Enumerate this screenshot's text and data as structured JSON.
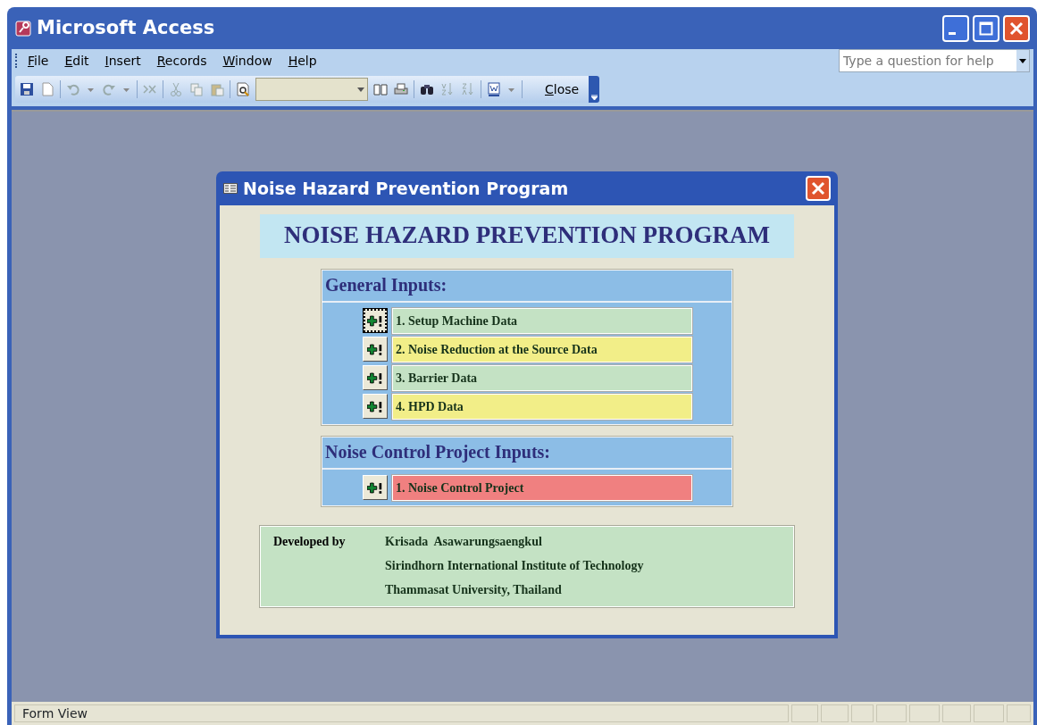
{
  "window": {
    "title": "Microsoft Access"
  },
  "menu": [
    "File",
    "Edit",
    "Insert",
    "Records",
    "Window",
    "Help"
  ],
  "help_box": {
    "placeholder": "Type a question for help"
  },
  "toolbar": {
    "close_label": "Close"
  },
  "form": {
    "title": "Noise Hazard Prevention Program",
    "heading": "NOISE HAZARD PREVENTION PROGRAM",
    "sections": [
      {
        "title": "General Inputs:",
        "items": [
          {
            "label": "1. Setup Machine Data",
            "color": "#c4e2c4",
            "focused": true
          },
          {
            "label": "2. Noise Reduction at the Source Data",
            "color": "#f2ee88",
            "focused": false
          },
          {
            "label": "3. Barrier Data",
            "color": "#c4e2c4",
            "focused": false
          },
          {
            "label": "4. HPD Data",
            "color": "#f2ee88",
            "focused": false
          }
        ]
      },
      {
        "title": "Noise Control Project Inputs:",
        "items": [
          {
            "label": "1. Noise Control Project",
            "color": "#f08080",
            "focused": false
          }
        ]
      }
    ],
    "credits": {
      "label": "Developed by",
      "lines": [
        "Krisada  Asawarungsaengkul",
        "Sirindhorn International Institute of Technology",
        "Thammasat University, Thailand"
      ]
    }
  },
  "status_bar": {
    "text": "Form View"
  }
}
